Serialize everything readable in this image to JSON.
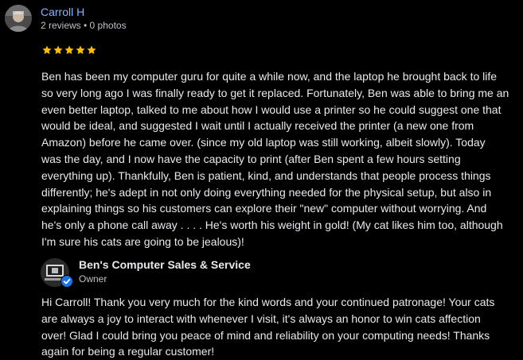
{
  "review": {
    "reviewer_name": "Carroll H",
    "reviewer_meta": "2 reviews • 0 photos",
    "rating": 5,
    "star_color": "#fbbc04",
    "text": "Ben has been my computer guru for quite a while now, and the laptop he brought back to life\nso very long ago I was finally ready to get it replaced. Fortunately, Ben was able to bring me an\neven better laptop, talked to me about how I would use a printer so he could suggest one that\nwould be ideal, and suggested I wait until I actually received the printer (a new one from\nAmazon) before he came over. (since my old laptop was still working, albeit slowly). Today\nwas the day, and I now have the capacity to print (after Ben spent a few hours setting\neverything up). Thankfully, Ben is patient, kind, and understands that people process things\ndifferently; he's adept in not only doing everything needed for the physical setup, but also in\nexplaining things so his customers can explore their \"new\" computer without worrying. And\nhe's only a phone call away . . . . He's worth his weight in gold! (My cat likes him too, although\nI'm sure his cats are going to be jealous)!"
  },
  "owner_reply": {
    "owner_name": "Ben's Computer Sales & Service",
    "owner_role": "Owner",
    "badge_color": "#1a73e8",
    "text": "Hi Carroll! Thank you very much for the kind words and your continued patronage! Your cats\nare always a joy to interact with whenever I visit, it's always an honor to win cats affection\nover! Glad I could bring you peace of mind and reliability on your computing needs! Thanks\nagain for being a regular customer!"
  },
  "colors": {
    "background": "#000000",
    "name_link": "#8ab4f8",
    "text": "#e8eaed",
    "secondary_text": "#bdc1c6"
  }
}
